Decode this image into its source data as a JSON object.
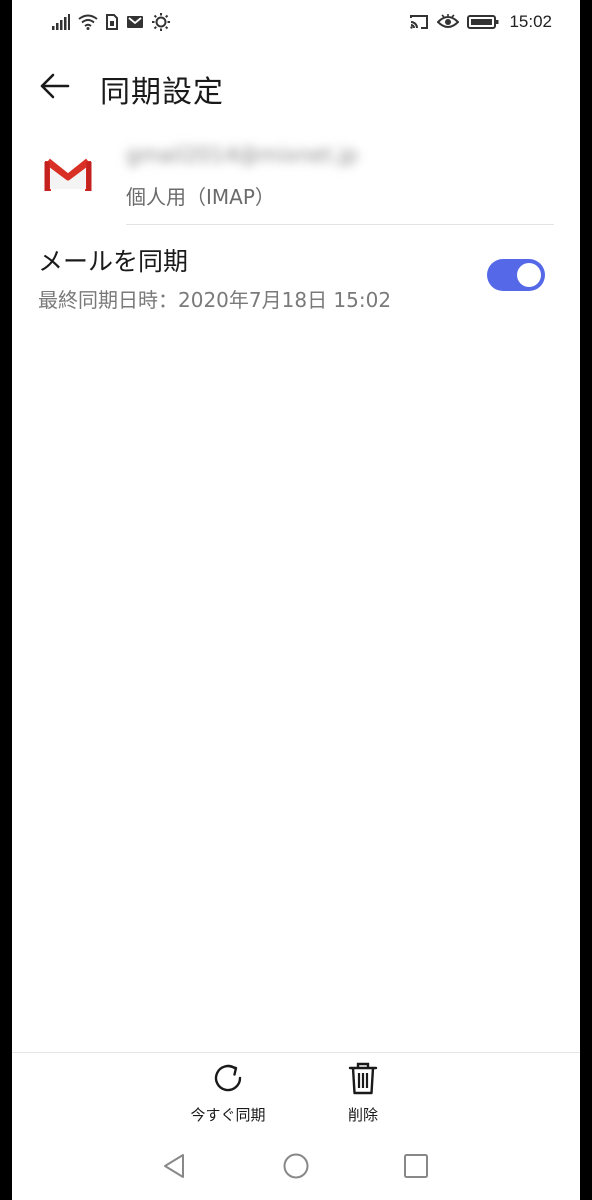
{
  "status_bar": {
    "time": "15:02",
    "icons_left": [
      "signal-icon",
      "wifi-icon",
      "sim-icon",
      "gmail-notification-icon",
      "brightness-icon"
    ],
    "icons_right": [
      "cast-icon",
      "eye-comfort-icon",
      "battery-icon"
    ]
  },
  "app_bar": {
    "title": "同期設定",
    "back_icon": "arrow-left-icon"
  },
  "account": {
    "email": "gmail2014@mixnet.jp",
    "type": "個人用（IMAP）",
    "logo": "gmail-logo"
  },
  "sync": {
    "title": "メールを同期",
    "last_synced": "最終同期日時：2020年7月18日 15:02",
    "enabled": true,
    "accent_color": "#5468e8"
  },
  "bottom_actions": {
    "sync_now_label": "今すぐ同期",
    "delete_label": "削除"
  },
  "nav_bar": {
    "icons": [
      "nav-back-icon",
      "nav-home-icon",
      "nav-recents-icon"
    ]
  }
}
